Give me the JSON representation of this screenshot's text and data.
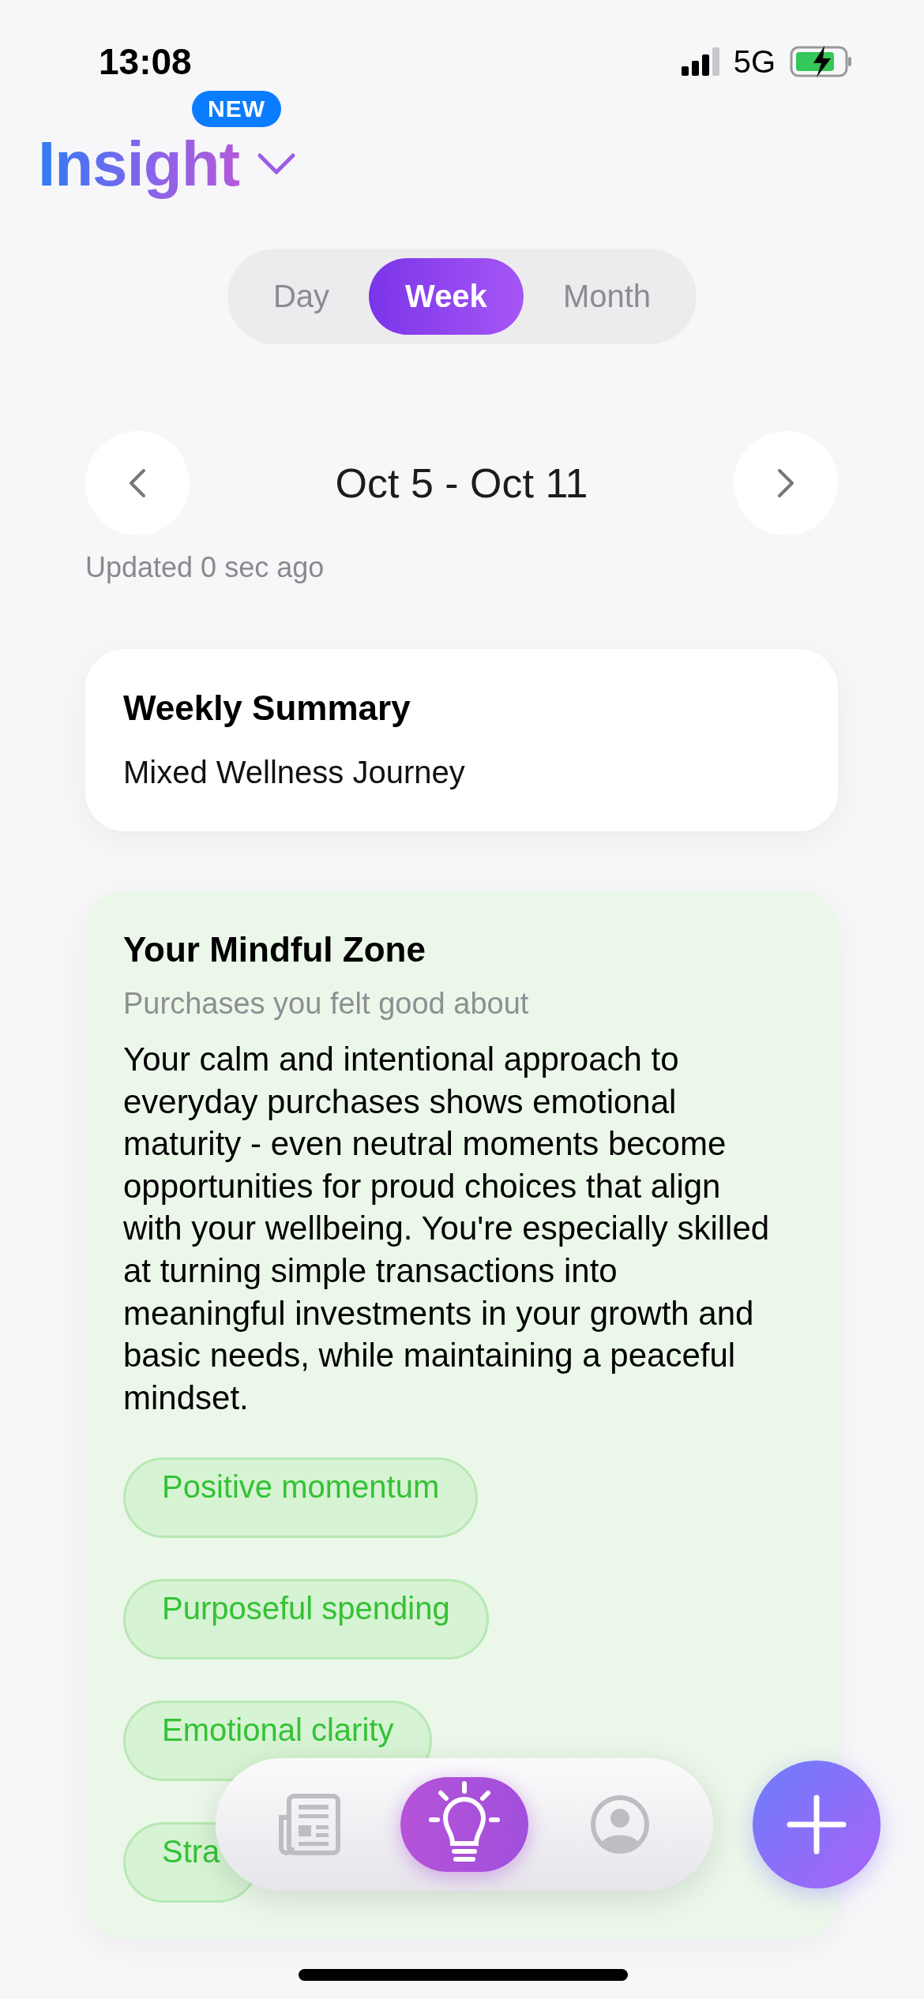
{
  "status_bar": {
    "time": "13:08",
    "network": "5G"
  },
  "header": {
    "title": "Insight",
    "badge": "NEW"
  },
  "period_tabs": [
    {
      "label": "Day",
      "selected": false
    },
    {
      "label": "Week",
      "selected": true
    },
    {
      "label": "Month",
      "selected": false
    }
  ],
  "date_nav": {
    "range": "Oct 5 - Oct 11",
    "updated": "Updated 0 sec ago"
  },
  "summary": {
    "title": "Weekly Summary",
    "text": "Mixed Wellness Journey"
  },
  "mindful_zone": {
    "title": "Your Mindful Zone",
    "subtitle": "Purchases you felt good about",
    "body": "Your calm and intentional approach to everyday purchases shows emotional maturity - even neutral moments become opportunities for proud choices that align with your wellbeing. You're especially skilled at turning simple transactions into meaningful investments in your growth and basic needs, while maintaining a peaceful mindset.",
    "tags": [
      "Positive momentum",
      "Purposeful spending",
      "Emotional clarity",
      "Stra"
    ]
  },
  "tab_bar": [
    {
      "kind": "news",
      "selected": false
    },
    {
      "kind": "insight",
      "selected": true
    },
    {
      "kind": "profile",
      "selected": false
    }
  ]
}
